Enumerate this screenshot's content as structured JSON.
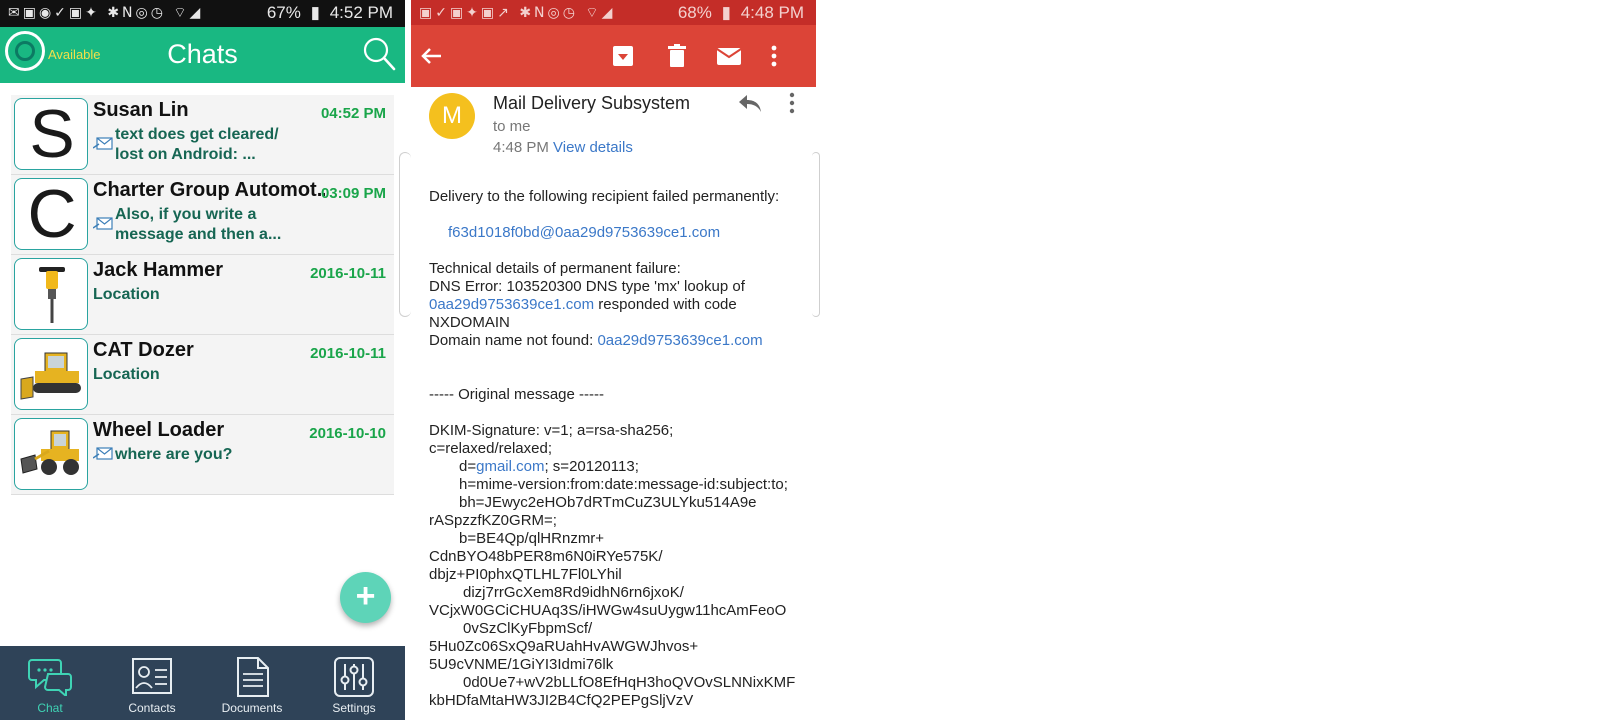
{
  "left": {
    "status": {
      "battery": "67%",
      "time": "4:52 PM"
    },
    "app": {
      "availability": "Available",
      "title": "Chats"
    },
    "chats": [
      {
        "avatar_letter": "S",
        "name": "Susan Lin",
        "time": "04:52 PM",
        "msg1": "text does get cleared/",
        "msg2": "lost on Android: ...",
        "has_msg_icon": true
      },
      {
        "avatar_letter": "C",
        "name": "Charter Group Automot...",
        "time": "03:09 PM",
        "msg1": "Also, if you write a",
        "msg2": "message and then a...",
        "has_msg_icon": true
      },
      {
        "avatar_icon": "jackhammer-icon",
        "name": "Jack Hammer",
        "time": "2016-10-11",
        "msg1": "Location",
        "msg2": "",
        "has_msg_icon": false
      },
      {
        "avatar_icon": "dozer-icon",
        "name": "CAT Dozer",
        "time": "2016-10-11",
        "msg1": "Location",
        "msg2": "",
        "has_msg_icon": false
      },
      {
        "avatar_icon": "wheel-loader-icon",
        "name": "Wheel Loader",
        "time": "2016-10-10",
        "msg1": "where are you?",
        "msg2": "",
        "has_msg_icon": true
      }
    ],
    "nav": [
      "Chat",
      "Contacts",
      "Documents",
      "Settings"
    ],
    "colors": {
      "appbar": "#19b882",
      "nav": "#2f4358",
      "accent": "#3fd3b4"
    }
  },
  "right": {
    "status": {
      "battery": "68%",
      "time": "4:48 PM"
    },
    "sender": {
      "initial": "M",
      "name": "Mail Delivery Subsystem",
      "to": "to me",
      "time": "4:48 PM",
      "details": "View details"
    },
    "body": {
      "l1": "Delivery to the following recipient failed permanently:",
      "recipient": "f63d1018f0bd@0aa29d9753639ce1.com",
      "l3": "Technical details of permanent failure:",
      "l4": "DNS Error: 103520300 DNS type 'mx' lookup of",
      "l5_link": "0aa29d9753639ce1.com",
      "l5_rest": " responded with code",
      "l6": "NXDOMAIN",
      "l7": "Domain name not found: ",
      "l7_link": "0aa29d9753639ce1.com",
      "l8": "----- Original message -----",
      "l9": "DKIM-Signature: v=1; a=rsa-sha256;",
      "l10": "c=relaxed/relaxed;",
      "l11_a": "d=",
      "l11_link": "gmail.com",
      "l11_b": "; s=20120113;",
      "l12": "h=mime-version:from:date:message-id:subject:to;",
      "l13": "bh=JEwyc2eHOb7dRTmCuZ3ULYku514A9e",
      "l14": "rASpzzfKZ0GRM=;",
      "l15": "b=BE4Qp/qlHRnzmr+",
      "l16": "CdnBYO48bPER8m6N0iRYe575K/",
      "l17": "dbjz+PI0phxQTLHL7Fl0LYhil",
      "l18": "dizj7rrGcXem8Rd9idhN6rn6jxoK/",
      "l19": "VCjxW0GCiCHUAq3S/iHWGw4suUygw11hcAmFeoO",
      "l20": "0vSzClKyFbpmScf/",
      "l21": "5Hu0Zc06SxQ9aRUahHvAWGWJhvos+",
      "l22": "5U9cVNME/1GiYI3Idmi76lk",
      "l23": "0d0Ue7+wV2bLLfO8EfHqH3hoQVOvSLNNixKMF",
      "l24": "kbHDfaMtaHW3JI2B4CfQ2PEPgSljVzV"
    },
    "colors": {
      "actionbar": "#dc4437",
      "link": "#3b78c8",
      "avatar": "#f4c01e"
    }
  }
}
